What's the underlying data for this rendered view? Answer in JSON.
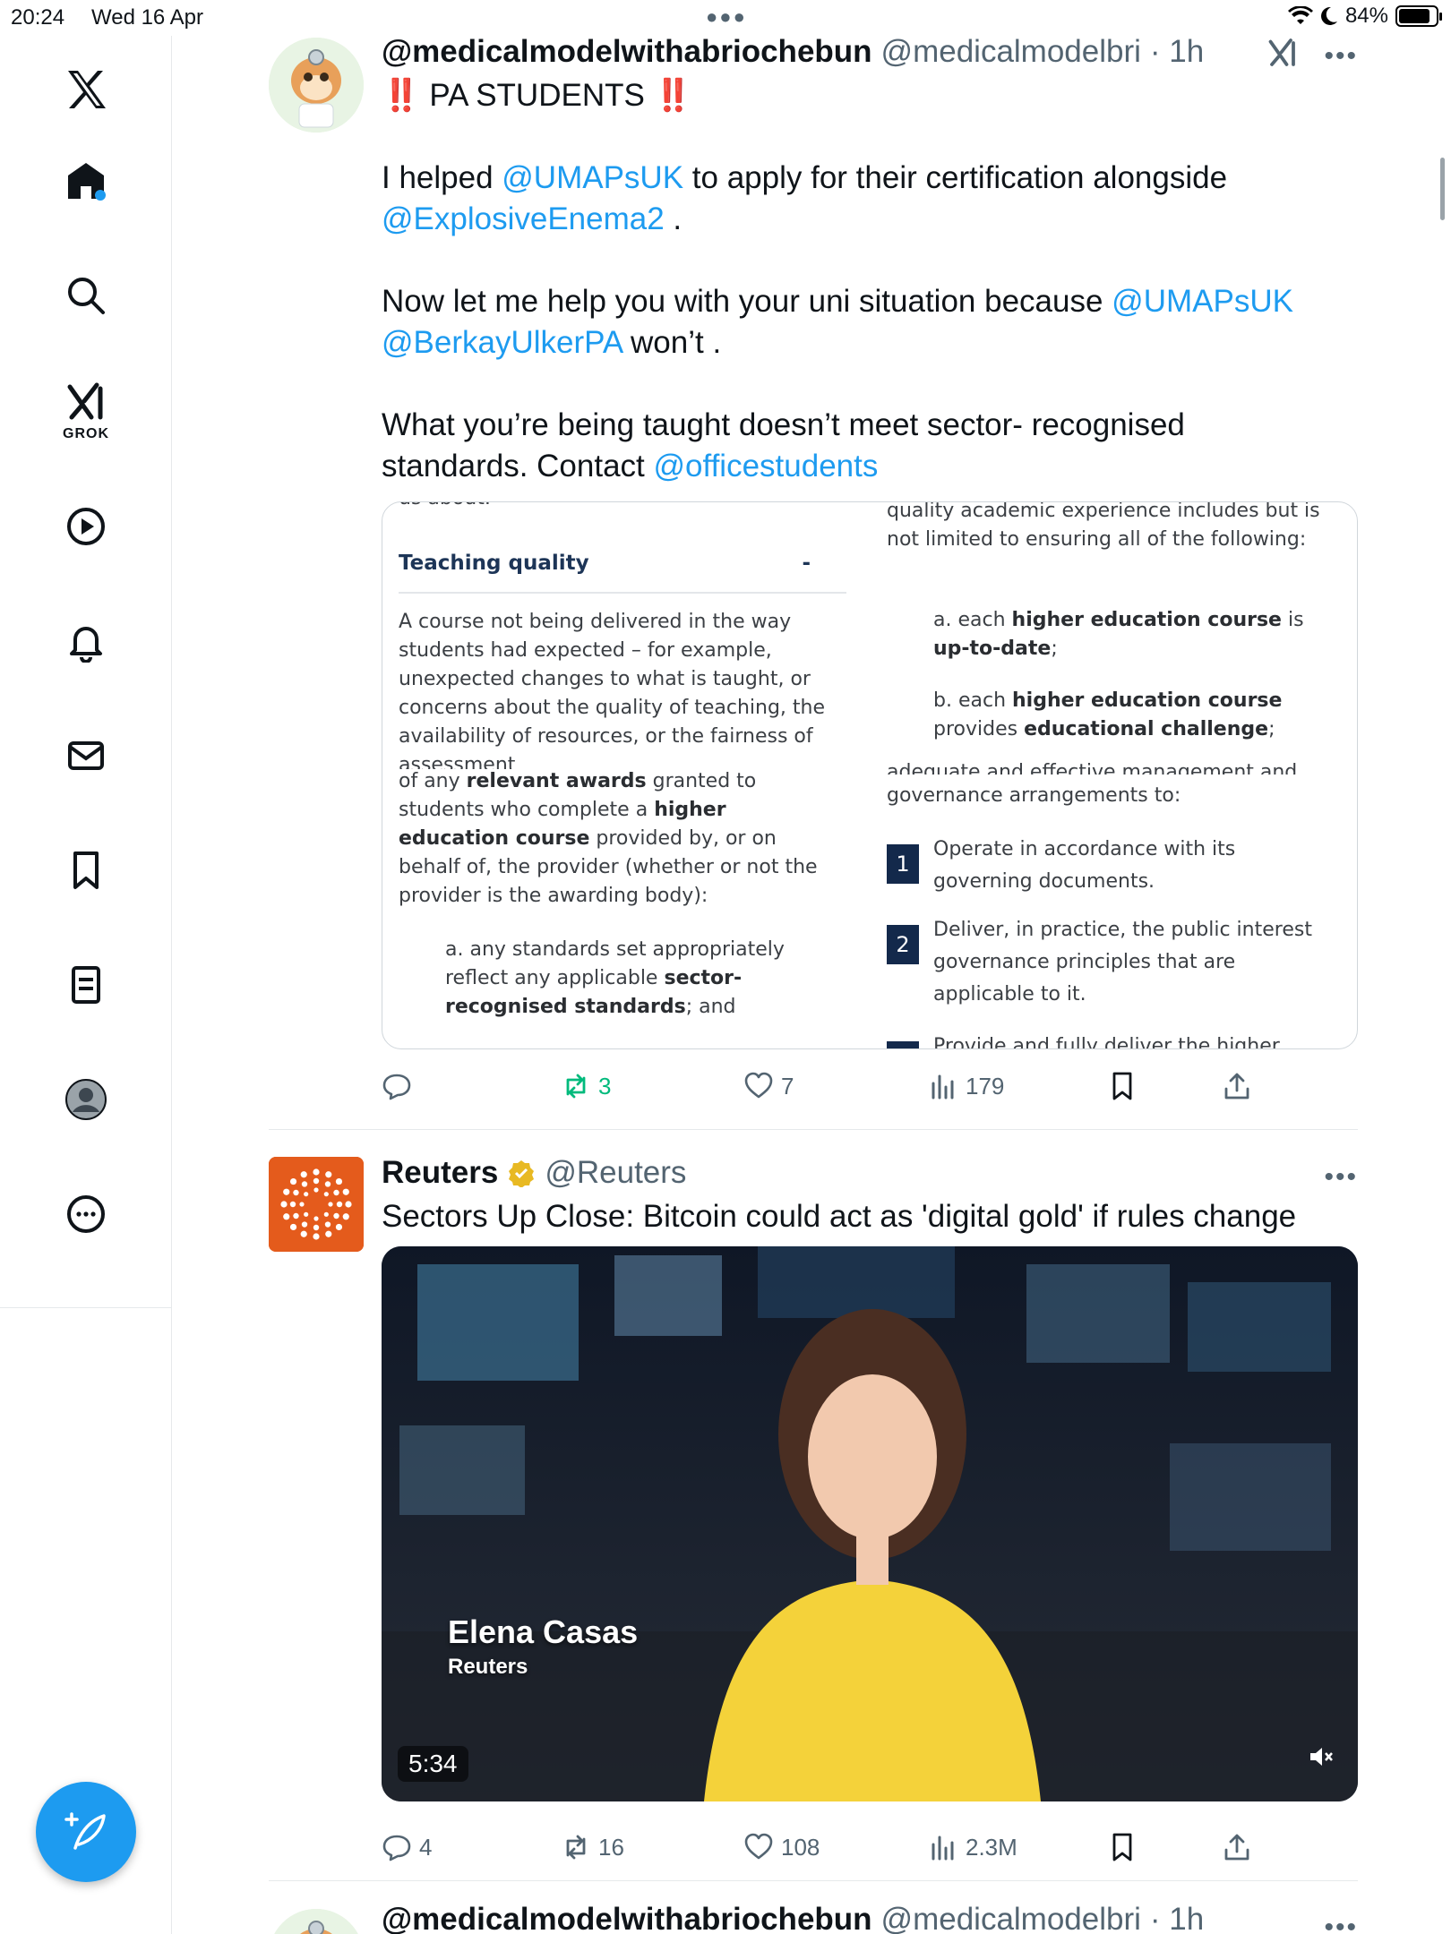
{
  "status_bar": {
    "time": "20:24",
    "date": "Wed 16 Apr",
    "battery": "84%"
  },
  "sidebar": {
    "grok_label": "GROK",
    "items": [
      "x-logo",
      "home-icon",
      "search-icon",
      "grok-icon",
      "video-icon",
      "notifications-icon",
      "messages-icon",
      "bookmarks-icon",
      "lists-icon",
      "profile-icon",
      "more-icon"
    ]
  },
  "colors": {
    "accent": "#1d9bf0",
    "repost_active": "#00ba7c",
    "text_secondary": "#536471",
    "reuters_orange": "#e45b1c",
    "doc_navy": "#13294b"
  },
  "tweets": [
    {
      "name": "@medicalmodelwithabriochebun",
      "handle": "@medicalmodelbri",
      "time": "· 1h",
      "line1_mark": "‼️",
      "line1_text": "PA STUDENTS",
      "p2_a": "I helped ",
      "p2_m1": "@UMAPsUK",
      "p2_b": " to apply for their certification alongside ",
      "p2_m2": "@ExplosiveEnema2",
      "p2_c": " .",
      "p3_a": "Now let me help you with your uni situation because ",
      "p3_m1": "@UMAPsUK",
      "p3_m2": "@BerkayUlkerPA",
      "p3_b": " won’t .",
      "p4_a": "What you’re being taught doesn’t meet sector- recognised standards. Contact ",
      "p4_m1": "@officestudents",
      "replies": "",
      "reposts": "3",
      "likes": "7",
      "views": "179",
      "doc": {
        "left_top_cut": "us about.",
        "teaching_heading": "Teaching quality",
        "teaching_dash": "-",
        "teaching_body": "A course not being delivered in the way students had expected – for example, unexpected changes to what is taught, or concerns about the quality of teaching, the availability of resources, or the fairness of assessment",
        "awards_a": "of any ",
        "awards_b": "relevant awards",
        "awards_c": " granted to students who complete a ",
        "awards_d": "higher education course",
        "awards_e": " provided by, or on behalf of, the provider (whether or not the provider is the awarding body):",
        "standards_a": "a. any standards set appropriately reflect any applicable ",
        "standards_b": "sector-recognised standards",
        "standards_c": "; and",
        "right_top": "quality academic experience includes but is not limited to ensuring all of the following:",
        "right_a1": "a. each ",
        "right_a2": "higher education course",
        "right_a3": " is ",
        "right_a4": "up-to-date",
        "right_a5": ";",
        "right_b1": "b. each ",
        "right_b2": "higher education course",
        "right_b3": " provides ",
        "right_b4": "educational challenge",
        "right_b5": ";",
        "right_mid_cut": "adequate and effective management and",
        "right_gov": "governance arrangements to:",
        "item1_num": "1",
        "item1_text": "Operate in accordance with its governing documents.",
        "item2_num": "2",
        "item2_text": "Deliver, in practice, the public interest governance principles that are applicable to it.",
        "item3_cut": "Provide and fully deliver the higher"
      }
    },
    {
      "name": "Reuters",
      "handle": "@Reuters",
      "text": "Sectors Up Close: Bitcoin could act as 'digital gold' if rules change",
      "video_duration": "5:34",
      "video_person": "Elena Casas",
      "video_org": "Reuters",
      "replies": "4",
      "reposts": "16",
      "likes": "108",
      "views": "2.3M"
    },
    {
      "name": "@medicalmodelwithabriochebun",
      "handle": "@medicalmodelbri",
      "time": "· 1h"
    }
  ]
}
